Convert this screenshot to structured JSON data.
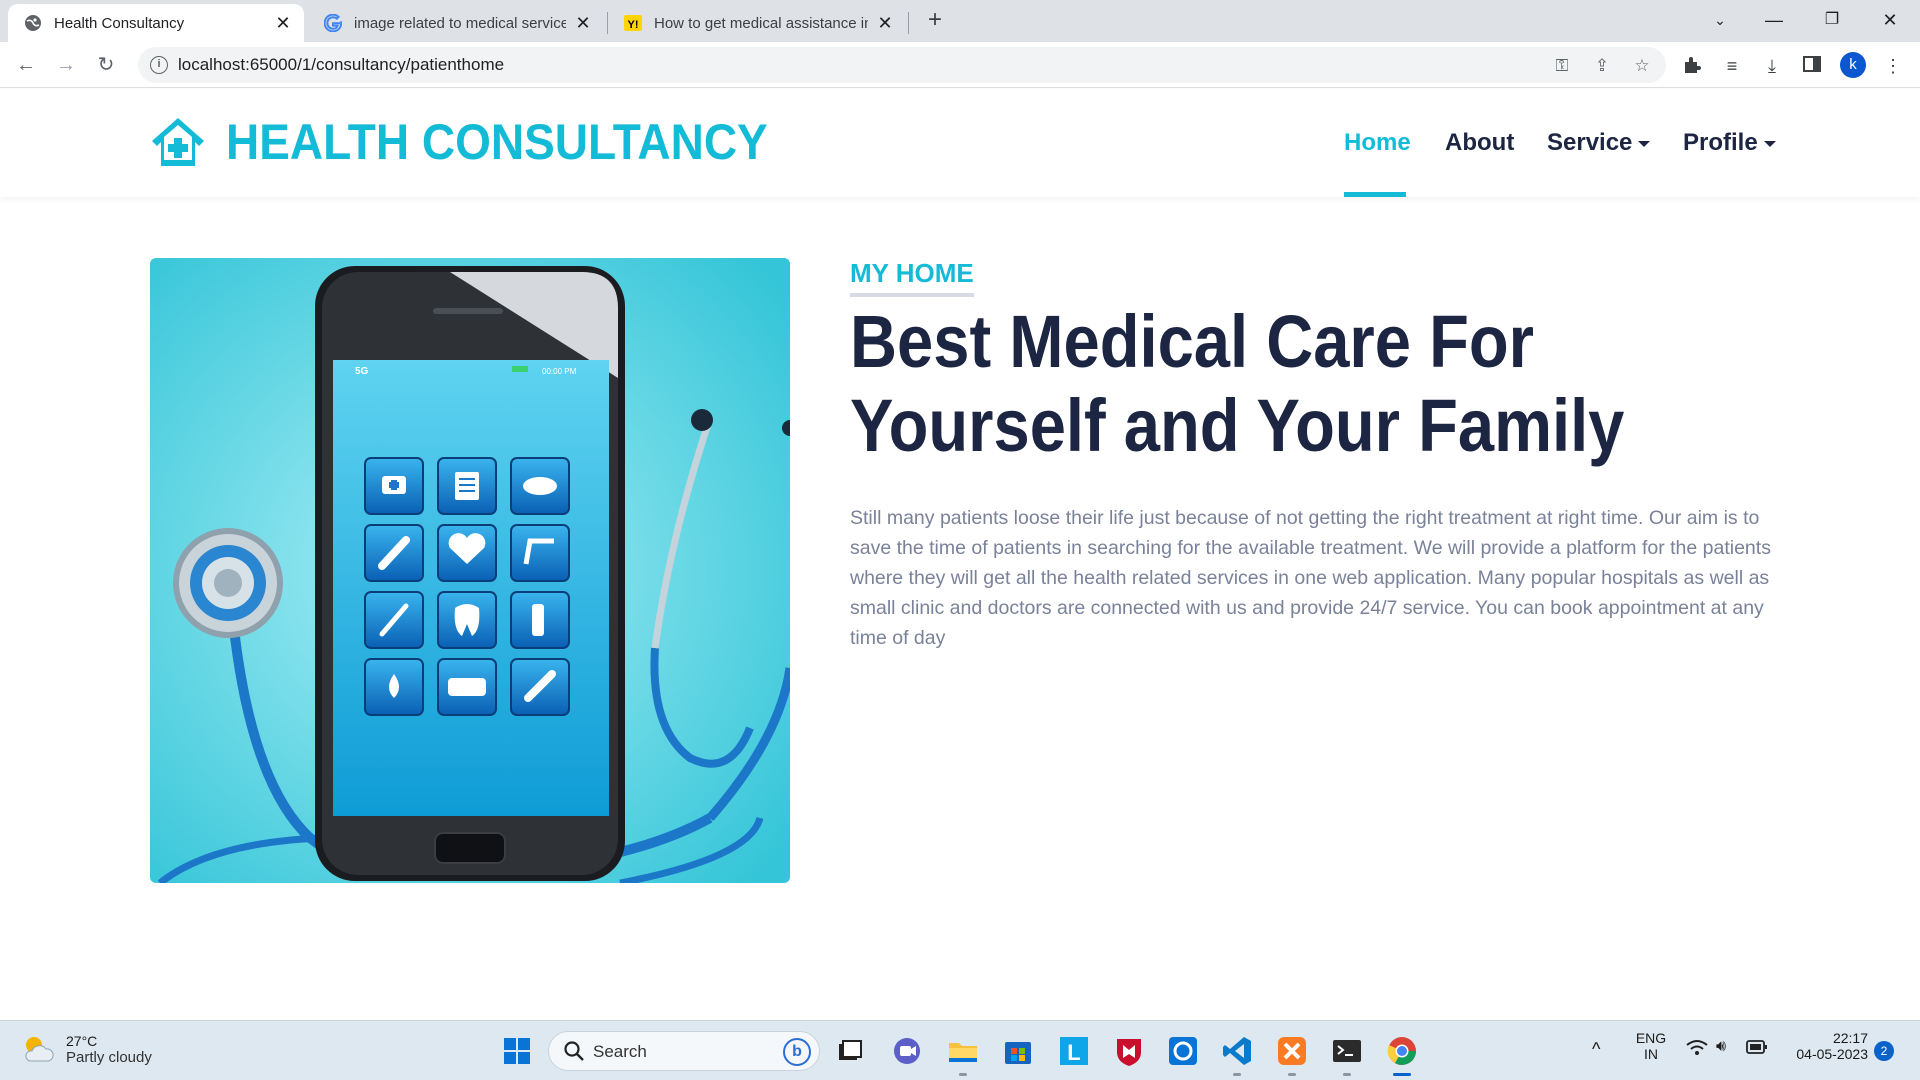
{
  "browser": {
    "tabs": [
      {
        "title": "Health Consultancy",
        "favicon": "globe-icon",
        "active": true
      },
      {
        "title": "image related to medical services",
        "favicon": "google-icon",
        "active": false
      },
      {
        "title": "How to get medical assistance in",
        "favicon": "site-icon",
        "active": false
      }
    ],
    "new_tab": "+",
    "url": "localhost:65000/1/consultancy/patienthome",
    "profile_initial": "k"
  },
  "site": {
    "brand_name": "HEALTH CONSULTANCY",
    "brand_icon": "house-medical-icon",
    "accent_color": "#13bbd6",
    "dark_color": "#1c2541",
    "nav": [
      {
        "label": "Home",
        "active": true,
        "dropdown": false
      },
      {
        "label": "About",
        "active": false,
        "dropdown": false
      },
      {
        "label": "Service",
        "active": false,
        "dropdown": true
      },
      {
        "label": "Profile",
        "active": false,
        "dropdown": true
      }
    ]
  },
  "main": {
    "kicker": "MY HOME",
    "headline": "Best Medical Care For Yourself and Your Family",
    "paragraph": "Still many patients loose their life just because of not getting the right treatment at right time. Our aim is to save the time of patients in searching for the available treatment. We will provide a platform for the patients where they will get all the health related services in one web application. Many popular hospitals as well as small clinic and doctors are connected with us and provide 24/7 service. You can book appointment at any time of day",
    "phone_status": {
      "network": "5G",
      "time": "00:00 PM"
    }
  },
  "taskbar": {
    "weather_temp": "27°C",
    "weather_desc": "Partly cloudy",
    "search_placeholder": "Search",
    "lang_top": "ENG",
    "lang_bottom": "IN",
    "time": "22:17",
    "date": "04-05-2023",
    "notifications": "2"
  }
}
